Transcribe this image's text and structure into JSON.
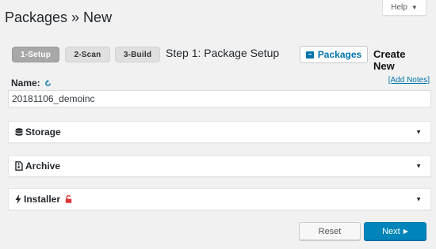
{
  "header": {
    "title": "Packages » New",
    "help_label": "Help",
    "help_caret": "▼"
  },
  "steps": {
    "items": [
      {
        "label": "1-Setup",
        "active": true
      },
      {
        "label": "2-Scan",
        "active": false
      },
      {
        "label": "3-Build",
        "active": false
      }
    ],
    "current_title": "Step 1: Package Setup"
  },
  "toolbar": {
    "packages_label": "Packages",
    "create_new_label": "Create New"
  },
  "form": {
    "name_label": "Name:",
    "add_notes_label": "[Add Notes]",
    "name_value": "20181106_demoinc"
  },
  "panels": {
    "storage": {
      "label": "Storage",
      "icon": "database-icon",
      "toggle": "▼"
    },
    "archive": {
      "label": "Archive",
      "icon": "file-archive-icon",
      "toggle": "▼"
    },
    "installer": {
      "label": "Installer",
      "icon": "bolt-icon",
      "toggle": "▼",
      "status_icon": "unlocked-lock-icon"
    }
  },
  "actions": {
    "reset_label": "Reset",
    "next_label": "Next",
    "next_arrow": "▶"
  },
  "colors": {
    "accent": "#0073aa",
    "primary_button": "#0085ba",
    "lock_red": "#dc3232",
    "background": "#f1f1f1"
  }
}
